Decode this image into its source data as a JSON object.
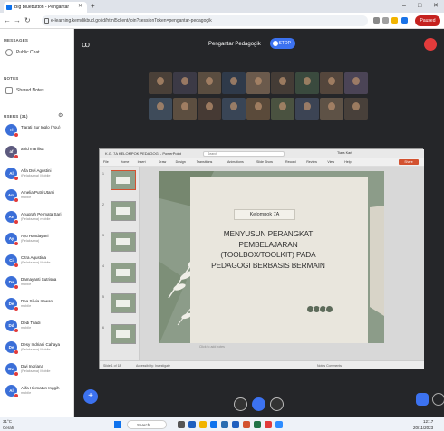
{
  "browser": {
    "tab_title": "Big Bluebutton - Pengantar",
    "url": "e-learning.kemdikbud.go.id/html5client/join?sessionToken=pengantar-pedagogik",
    "profile_label": "Paused"
  },
  "sidebar": {
    "messages_title": "MESSAGES",
    "public_chat": "Public Chat",
    "notes_title": "NOTES",
    "shared_notes": "Shared Notes",
    "users_title": "USERS (31)",
    "users": [
      {
        "initials": "Ti",
        "name": "Tiarati Sur Inglo (You)",
        "role": "",
        "color": "#3b6fd8"
      },
      {
        "initials": "af",
        "name": "afrid marilisa",
        "role": "",
        "color": "#5d5a7e"
      },
      {
        "initials": "Al",
        "name": "Alfa Dwi Agustini",
        "role": "(Pelaksana) Mobile",
        "color": "#3b6fd8"
      },
      {
        "initials": "Am",
        "name": "Amelia Putri Utami",
        "role": "mobile",
        "color": "#3b6fd8"
      },
      {
        "initials": "An",
        "name": "Anugrah Permata Sari",
        "role": "(Pelaksana) mobile",
        "color": "#3b6fd8"
      },
      {
        "initials": "Ay",
        "name": "Ayu Handayani",
        "role": "(Pelaksana)",
        "color": "#3b6fd8"
      },
      {
        "initials": "Ci",
        "name": "Citra Agustina",
        "role": "(Pelaksana) Mobile",
        "color": "#3b6fd8"
      },
      {
        "initials": "Da",
        "name": "Damayanti Sutrisna",
        "role": "mobile",
        "color": "#3b6fd8"
      },
      {
        "initials": "De",
        "name": "Dea Silvia Irawan",
        "role": "mobile",
        "color": "#3b6fd8"
      },
      {
        "initials": "Dd",
        "name": "Dedi Triadi",
        "role": "mobile",
        "color": "#3b6fd8"
      },
      {
        "initials": "De",
        "name": "Desy Indriani Cahaya",
        "role": "(Pelaksana) Mobile",
        "color": "#3b6fd8"
      },
      {
        "initials": "Dw",
        "name": "Dwi Indriana",
        "role": "(Pelaksana) Mobile",
        "color": "#3b6fd8"
      },
      {
        "initials": "Al",
        "name": "Alifa Hikmatun Inggih",
        "role": "mobile",
        "color": "#3b6fd8"
      }
    ]
  },
  "meeting": {
    "title": "Pengantar Pedagogik",
    "stop_label": "STOP"
  },
  "ppt": {
    "window_title": "K.G. 7A KELOMPOK PEDAGOGI - PowerPoint",
    "search_placeholder": "Search",
    "user_name": "Tiara Karli",
    "menu": [
      "File",
      "Home",
      "Insert",
      "Draw",
      "Design",
      "Transitions",
      "Animations",
      "Slide Show",
      "Record",
      "Review",
      "View",
      "Help"
    ],
    "share_label": "Share",
    "notes_placeholder": "Click to add notes",
    "status_left": "Slide 1 of 18",
    "status_accessibility": "Accessibility: Investigate",
    "status_right": "Notes   Comments",
    "thumb_numbers": [
      "1",
      "2",
      "3",
      "4",
      "5",
      "6"
    ],
    "slide": {
      "group_label": "Kelompok 7A",
      "title_lines": [
        "MENYUSUN PERANGKAT",
        "PEMBELAJARAN",
        "(TOOLBOX/TOOLKIT) PADA",
        "PEDAGOGI BERBASIS BERMAIN"
      ]
    }
  },
  "taskbar": {
    "weather_temp": "31°C",
    "weather_desc": "Cerah",
    "search_label": "Search",
    "time": "12:17",
    "date": "20/11/2023"
  }
}
